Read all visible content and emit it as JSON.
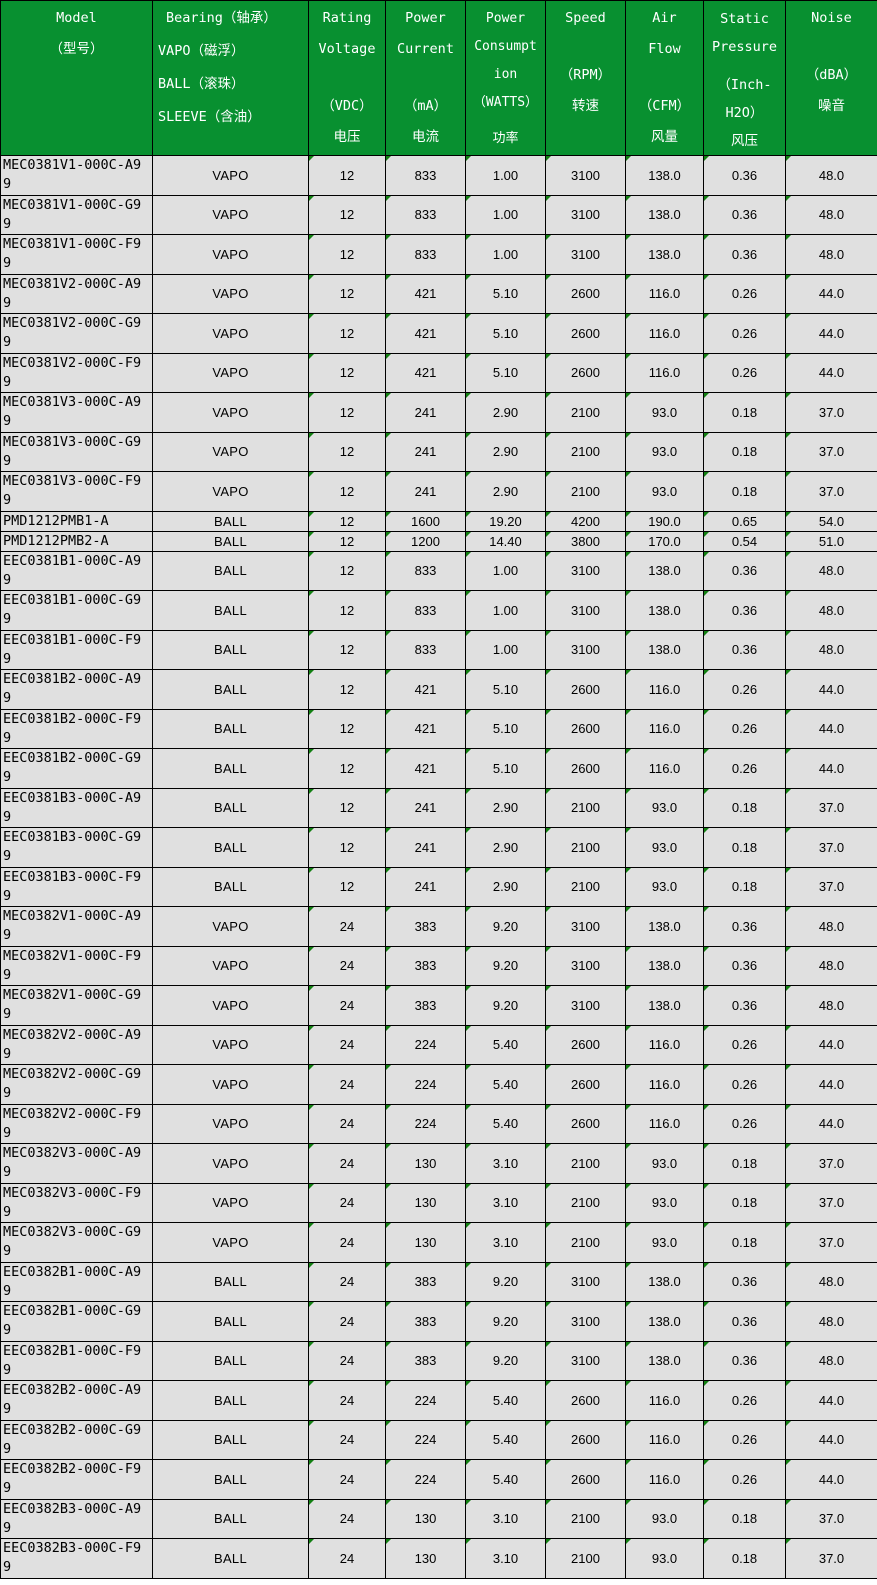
{
  "table": {
    "columns": [
      {
        "key": "model",
        "lines": [
          "Model",
          "（型号）"
        ]
      },
      {
        "key": "bearing",
        "lines": [
          "Bearing（轴承）",
          "VAPO（磁浮）",
          "BALL（滚珠）",
          "SLEEVE（含油）"
        ]
      },
      {
        "key": "voltage",
        "lines": [
          "Rating",
          "Voltage",
          "（VDC）",
          "电压"
        ]
      },
      {
        "key": "current",
        "lines": [
          "Power",
          "Current",
          "（mA）",
          "电流"
        ]
      },
      {
        "key": "consumption",
        "lines": [
          "Power",
          "Consumpt",
          "ion",
          "（WATTS）",
          "功率"
        ]
      },
      {
        "key": "speed",
        "lines": [
          "Speed",
          "（RPM）",
          "转速"
        ]
      },
      {
        "key": "airflow",
        "lines": [
          "Air",
          "Flow",
          "（CFM）",
          "风量"
        ]
      },
      {
        "key": "static",
        "lines": [
          "Static",
          "Pressure",
          "（Inch-",
          "H2O）",
          "风压"
        ]
      },
      {
        "key": "noise",
        "lines": [
          "Noise",
          "（dBA）",
          "噪音"
        ]
      }
    ],
    "rows": [
      {
        "model": "MEC0381V1-000C-A99",
        "bearing": "VAPO",
        "voltage": "12",
        "current": "833",
        "consumption": "1.00",
        "speed": "3100",
        "airflow": "138.0",
        "static": "0.36",
        "noise": "48.0"
      },
      {
        "model": "MEC0381V1-000C-G99",
        "bearing": "VAPO",
        "voltage": "12",
        "current": "833",
        "consumption": "1.00",
        "speed": "3100",
        "airflow": "138.0",
        "static": "0.36",
        "noise": "48.0"
      },
      {
        "model": "MEC0381V1-000C-F99",
        "bearing": "VAPO",
        "voltage": "12",
        "current": "833",
        "consumption": "1.00",
        "speed": "3100",
        "airflow": "138.0",
        "static": "0.36",
        "noise": "48.0"
      },
      {
        "model": "MEC0381V2-000C-A99",
        "bearing": "VAPO",
        "voltage": "12",
        "current": "421",
        "consumption": "5.10",
        "speed": "2600",
        "airflow": "116.0",
        "static": "0.26",
        "noise": "44.0"
      },
      {
        "model": "MEC0381V2-000C-G99",
        "bearing": "VAPO",
        "voltage": "12",
        "current": "421",
        "consumption": "5.10",
        "speed": "2600",
        "airflow": "116.0",
        "static": "0.26",
        "noise": "44.0"
      },
      {
        "model": "MEC0381V2-000C-F99",
        "bearing": "VAPO",
        "voltage": "12",
        "current": "421",
        "consumption": "5.10",
        "speed": "2600",
        "airflow": "116.0",
        "static": "0.26",
        "noise": "44.0"
      },
      {
        "model": "MEC0381V3-000C-A99",
        "bearing": "VAPO",
        "voltage": "12",
        "current": "241",
        "consumption": "2.90",
        "speed": "2100",
        "airflow": "93.0",
        "static": "0.18",
        "noise": "37.0"
      },
      {
        "model": "MEC0381V3-000C-G99",
        "bearing": "VAPO",
        "voltage": "12",
        "current": "241",
        "consumption": "2.90",
        "speed": "2100",
        "airflow": "93.0",
        "static": "0.18",
        "noise": "37.0"
      },
      {
        "model": "MEC0381V3-000C-F99",
        "bearing": "VAPO",
        "voltage": "12",
        "current": "241",
        "consumption": "2.90",
        "speed": "2100",
        "airflow": "93.0",
        "static": "0.18",
        "noise": "37.0"
      },
      {
        "model": "PMD1212PMB1-A",
        "bearing": "BALL",
        "voltage": "12",
        "current": "1600",
        "consumption": "19.20",
        "speed": "4200",
        "airflow": "190.0",
        "static": "0.65",
        "noise": "54.0",
        "single": true
      },
      {
        "model": "PMD1212PMB2-A",
        "bearing": "BALL",
        "voltage": "12",
        "current": "1200",
        "consumption": "14.40",
        "speed": "3800",
        "airflow": "170.0",
        "static": "0.54",
        "noise": "51.0",
        "single": true
      },
      {
        "model": "EEC0381B1-000C-A99",
        "bearing": "BALL",
        "voltage": "12",
        "current": "833",
        "consumption": "1.00",
        "speed": "3100",
        "airflow": "138.0",
        "static": "0.36",
        "noise": "48.0"
      },
      {
        "model": "EEC0381B1-000C-G99",
        "bearing": "BALL",
        "voltage": "12",
        "current": "833",
        "consumption": "1.00",
        "speed": "3100",
        "airflow": "138.0",
        "static": "0.36",
        "noise": "48.0"
      },
      {
        "model": "EEC0381B1-000C-F99",
        "bearing": "BALL",
        "voltage": "12",
        "current": "833",
        "consumption": "1.00",
        "speed": "3100",
        "airflow": "138.0",
        "static": "0.36",
        "noise": "48.0"
      },
      {
        "model": "EEC0381B2-000C-A99",
        "bearing": "BALL",
        "voltage": "12",
        "current": "421",
        "consumption": "5.10",
        "speed": "2600",
        "airflow": "116.0",
        "static": "0.26",
        "noise": "44.0"
      },
      {
        "model": "EEC0381B2-000C-F99",
        "bearing": "BALL",
        "voltage": "12",
        "current": "421",
        "consumption": "5.10",
        "speed": "2600",
        "airflow": "116.0",
        "static": "0.26",
        "noise": "44.0"
      },
      {
        "model": "EEC0381B2-000C-G99",
        "bearing": "BALL",
        "voltage": "12",
        "current": "421",
        "consumption": "5.10",
        "speed": "2600",
        "airflow": "116.0",
        "static": "0.26",
        "noise": "44.0"
      },
      {
        "model": "EEC0381B3-000C-A99",
        "bearing": "BALL",
        "voltage": "12",
        "current": "241",
        "consumption": "2.90",
        "speed": "2100",
        "airflow": "93.0",
        "static": "0.18",
        "noise": "37.0"
      },
      {
        "model": "EEC0381B3-000C-G99",
        "bearing": "BALL",
        "voltage": "12",
        "current": "241",
        "consumption": "2.90",
        "speed": "2100",
        "airflow": "93.0",
        "static": "0.18",
        "noise": "37.0"
      },
      {
        "model": "EEC0381B3-000C-F99",
        "bearing": "BALL",
        "voltage": "12",
        "current": "241",
        "consumption": "2.90",
        "speed": "2100",
        "airflow": "93.0",
        "static": "0.18",
        "noise": "37.0"
      },
      {
        "model": "MEC0382V1-000C-A99",
        "bearing": "VAPO",
        "voltage": "24",
        "current": "383",
        "consumption": "9.20",
        "speed": "3100",
        "airflow": "138.0",
        "static": "0.36",
        "noise": "48.0"
      },
      {
        "model": "MEC0382V1-000C-F99",
        "bearing": "VAPO",
        "voltage": "24",
        "current": "383",
        "consumption": "9.20",
        "speed": "3100",
        "airflow": "138.0",
        "static": "0.36",
        "noise": "48.0"
      },
      {
        "model": "MEC0382V1-000C-G99",
        "bearing": "VAPO",
        "voltage": "24",
        "current": "383",
        "consumption": "9.20",
        "speed": "3100",
        "airflow": "138.0",
        "static": "0.36",
        "noise": "48.0"
      },
      {
        "model": "MEC0382V2-000C-A99",
        "bearing": "VAPO",
        "voltage": "24",
        "current": "224",
        "consumption": "5.40",
        "speed": "2600",
        "airflow": "116.0",
        "static": "0.26",
        "noise": "44.0"
      },
      {
        "model": "MEC0382V2-000C-G99",
        "bearing": "VAPO",
        "voltage": "24",
        "current": "224",
        "consumption": "5.40",
        "speed": "2600",
        "airflow": "116.0",
        "static": "0.26",
        "noise": "44.0"
      },
      {
        "model": "MEC0382V2-000C-F99",
        "bearing": "VAPO",
        "voltage": "24",
        "current": "224",
        "consumption": "5.40",
        "speed": "2600",
        "airflow": "116.0",
        "static": "0.26",
        "noise": "44.0"
      },
      {
        "model": "MEC0382V3-000C-A99",
        "bearing": "VAPO",
        "voltage": "24",
        "current": "130",
        "consumption": "3.10",
        "speed": "2100",
        "airflow": "93.0",
        "static": "0.18",
        "noise": "37.0"
      },
      {
        "model": "MEC0382V3-000C-F99",
        "bearing": "VAPO",
        "voltage": "24",
        "current": "130",
        "consumption": "3.10",
        "speed": "2100",
        "airflow": "93.0",
        "static": "0.18",
        "noise": "37.0"
      },
      {
        "model": "MEC0382V3-000C-G99",
        "bearing": "VAPO",
        "voltage": "24",
        "current": "130",
        "consumption": "3.10",
        "speed": "2100",
        "airflow": "93.0",
        "static": "0.18",
        "noise": "37.0"
      },
      {
        "model": "EEC0382B1-000C-A99",
        "bearing": "BALL",
        "voltage": "24",
        "current": "383",
        "consumption": "9.20",
        "speed": "3100",
        "airflow": "138.0",
        "static": "0.36",
        "noise": "48.0"
      },
      {
        "model": "EEC0382B1-000C-G99",
        "bearing": "BALL",
        "voltage": "24",
        "current": "383",
        "consumption": "9.20",
        "speed": "3100",
        "airflow": "138.0",
        "static": "0.36",
        "noise": "48.0"
      },
      {
        "model": "EEC0382B1-000C-F99",
        "bearing": "BALL",
        "voltage": "24",
        "current": "383",
        "consumption": "9.20",
        "speed": "3100",
        "airflow": "138.0",
        "static": "0.36",
        "noise": "48.0"
      },
      {
        "model": "EEC0382B2-000C-A99",
        "bearing": "BALL",
        "voltage": "24",
        "current": "224",
        "consumption": "5.40",
        "speed": "2600",
        "airflow": "116.0",
        "static": "0.26",
        "noise": "44.0"
      },
      {
        "model": "EEC0382B2-000C-G99",
        "bearing": "BALL",
        "voltage": "24",
        "current": "224",
        "consumption": "5.40",
        "speed": "2600",
        "airflow": "116.0",
        "static": "0.26",
        "noise": "44.0"
      },
      {
        "model": "EEC0382B2-000C-F99",
        "bearing": "BALL",
        "voltage": "24",
        "current": "224",
        "consumption": "5.40",
        "speed": "2600",
        "airflow": "116.0",
        "static": "0.26",
        "noise": "44.0"
      },
      {
        "model": "EEC0382B3-000C-A99",
        "bearing": "BALL",
        "voltage": "24",
        "current": "130",
        "consumption": "3.10",
        "speed": "2100",
        "airflow": "93.0",
        "static": "0.18",
        "noise": "37.0"
      },
      {
        "model": "EEC0382B3-000C-F99",
        "bearing": "BALL",
        "voltage": "24",
        "current": "130",
        "consumption": "3.10",
        "speed": "2100",
        "airflow": "93.0",
        "static": "0.18",
        "noise": "37.0"
      }
    ]
  },
  "colors": {
    "header_green": "#089030",
    "row_grey": "#e0e0e0",
    "grid_black": "#000000",
    "comment_marker_green": "#128012"
  }
}
